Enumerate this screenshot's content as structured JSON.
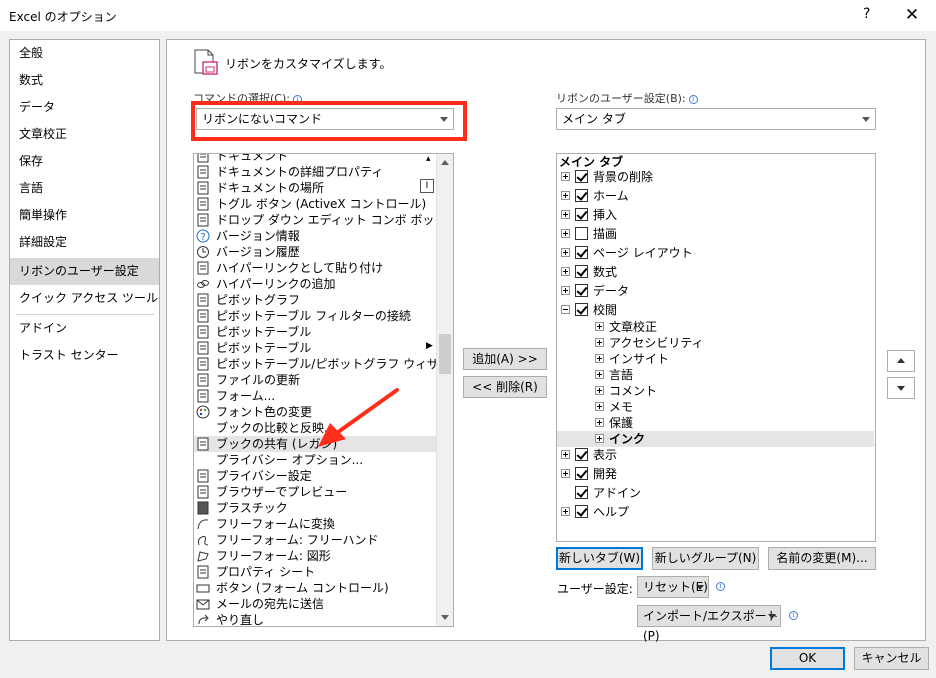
{
  "window": {
    "title": "Excel のオプション",
    "help_label": "?",
    "close_label": "✕"
  },
  "nav": {
    "items": [
      "全般",
      "数式",
      "データ",
      "文章校正",
      "保存",
      "言語",
      "簡単操作",
      "詳細設定",
      "リボンのユーザー設定",
      "クイック アクセス ツール バー",
      "アドイン",
      "トラスト センター"
    ],
    "selected": "リボンのユーザー設定"
  },
  "header": {
    "title": "リボンをカスタマイズします。"
  },
  "commands": {
    "label": "コマンドの選択(C):",
    "selected": "リボンにないコマンド",
    "items": [
      {
        "label": "ドキュメント",
        "icon": "document-icon"
      },
      {
        "label": "ドキュメントの詳細プロパティ",
        "icon": "properties-icon"
      },
      {
        "label": "ドキュメントの場所",
        "icon": "location-icon"
      },
      {
        "label": "トグル ボタン (ActiveX コントロール)",
        "icon": "toggle-button-icon"
      },
      {
        "label": "ドロップ ダウン エディット コンボ ボックス (…",
        "icon": "combo-box-icon"
      },
      {
        "label": "バージョン情報",
        "icon": "help-circle-icon"
      },
      {
        "label": "バージョン履歴",
        "icon": "history-icon"
      },
      {
        "label": "ハイパーリンクとして貼り付け",
        "icon": "paste-link-icon"
      },
      {
        "label": "ハイパーリンクの追加",
        "icon": "link-icon"
      },
      {
        "label": "ピボットグラフ",
        "icon": "pivot-chart-icon"
      },
      {
        "label": "ピボットテーブル フィルターの接続",
        "icon": "filter-connect-icon"
      },
      {
        "label": "ピボットテーブル",
        "icon": "pivot-table-icon"
      },
      {
        "label": "ピボットテーブル",
        "icon": "pivot-table-icon"
      },
      {
        "label": "ピボットテーブル/ピボットグラフ ウィザード",
        "icon": "wizard-icon"
      },
      {
        "label": "ファイルの更新",
        "icon": "refresh-file-icon"
      },
      {
        "label": "フォーム...",
        "icon": "form-icon"
      },
      {
        "label": "フォント色の変更",
        "icon": "palette-icon"
      },
      {
        "label": "ブックの比較と反映...",
        "icon": "blank-icon"
      },
      {
        "label": "ブックの共有 (レガシ)",
        "icon": "share-workbook-icon"
      },
      {
        "label": "プライバシー オプション...",
        "icon": "blank-icon"
      },
      {
        "label": "プライバシー設定",
        "icon": "privacy-icon"
      },
      {
        "label": "ブラウザーでプレビュー",
        "icon": "browser-preview-icon"
      },
      {
        "label": "プラスチック",
        "icon": "plastic-icon"
      },
      {
        "label": "フリーフォームに変換",
        "icon": "freeform-convert-icon"
      },
      {
        "label": "フリーフォーム: フリーハンド",
        "icon": "freehand-icon"
      },
      {
        "label": "フリーフォーム: 図形",
        "icon": "freeform-shape-icon"
      },
      {
        "label": "プロパティ シート",
        "icon": "property-sheet-icon"
      },
      {
        "label": "ボタン (フォーム コントロール)",
        "icon": "form-button-icon"
      },
      {
        "label": "メールの宛先に送信",
        "icon": "mail-icon"
      },
      {
        "label": "やり直し",
        "icon": "redo-icon"
      }
    ],
    "selected_index": 18
  },
  "ribbon": {
    "label": "リボンのユーザー設定(B):",
    "selected": "メイン タブ",
    "tree_header": "メイン タブ",
    "tabs": [
      {
        "label": "背景の削除",
        "checked": true,
        "expand": "plus"
      },
      {
        "label": "ホーム",
        "checked": true,
        "expand": "plus"
      },
      {
        "label": "挿入",
        "checked": true,
        "expand": "plus"
      },
      {
        "label": "描画",
        "checked": false,
        "expand": "plus"
      },
      {
        "label": "ページ レイアウト",
        "checked": true,
        "expand": "plus"
      },
      {
        "label": "数式",
        "checked": true,
        "expand": "plus"
      },
      {
        "label": "データ",
        "checked": true,
        "expand": "plus"
      },
      {
        "label": "校閲",
        "checked": true,
        "expand": "minus"
      }
    ],
    "review_groups": [
      "文章校正",
      "アクセシビリティ",
      "インサイト",
      "言語",
      "コメント",
      "メモ",
      "保護",
      "インク"
    ],
    "selected_group": "インク",
    "after_tabs": [
      {
        "label": "表示",
        "checked": true,
        "expand": "plus"
      },
      {
        "label": "開発",
        "checked": true,
        "expand": "plus"
      },
      {
        "label": "アドイン",
        "checked": true,
        "expand": "none"
      },
      {
        "label": "ヘルプ",
        "checked": true,
        "expand": "plus"
      }
    ]
  },
  "buttons": {
    "add": "追加(A) >>",
    "remove": "<< 削除(R)",
    "new_tab": "新しいタブ(W)",
    "new_group": "新しいグループ(N)",
    "rename": "名前の変更(M)...",
    "user_settings_label": "ユーザー設定:",
    "reset": "リセット(E)",
    "import_export": "インポート/エクスポート(P)",
    "ok": "OK",
    "cancel": "キャンセル"
  },
  "colors": {
    "highlight_red": "#ff2e1a",
    "selection": "#e5e5e5",
    "nav_selection": "#d9d9d9",
    "primary_border": "#0078d7"
  }
}
